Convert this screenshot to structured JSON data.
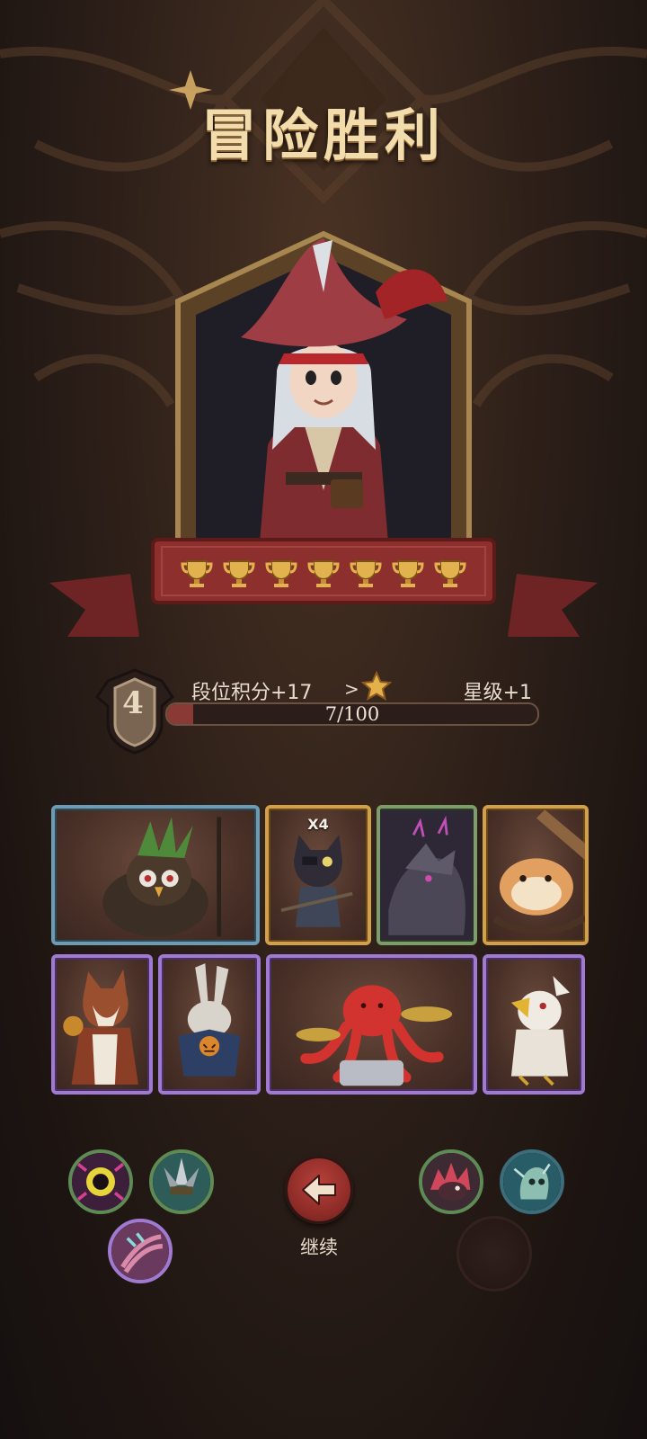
{
  "title": "冒险胜利",
  "hero": {
    "trophy_count": 7,
    "trophy_icon": "trophy-icon"
  },
  "rank": {
    "level": "4",
    "score_label": "段位积分+17",
    "arrow": ">",
    "star_label": "星级+1",
    "progress_text": "7/100",
    "progress_fraction": 0.07
  },
  "cards": [
    {
      "name": "owl-shaman",
      "frame": "blue",
      "badge": ""
    },
    {
      "name": "cat-pirate",
      "frame": "gold",
      "badge": "X4"
    },
    {
      "name": "dark-dragon",
      "frame": "green",
      "badge": ""
    },
    {
      "name": "hamster",
      "frame": "gold",
      "badge": ""
    },
    {
      "name": "squirrel",
      "frame": "purple",
      "badge": ""
    },
    {
      "name": "rabbit-scarecrow",
      "frame": "purple",
      "badge": ""
    },
    {
      "name": "octopus-drummer",
      "frame": "purple",
      "badge": ""
    },
    {
      "name": "cockatoo",
      "frame": "purple",
      "badge": ""
    }
  ],
  "skills_left": [
    "eye-skill-icon",
    "spike-skill-icon",
    "claw-skill-icon"
  ],
  "skills_right": [
    "beast-skill-icon",
    "ghost-skill-icon"
  ],
  "continue_label": "继续",
  "colors": {
    "title": "#f3dcab",
    "button": "#9a302b",
    "progress": "#8a3a34"
  }
}
